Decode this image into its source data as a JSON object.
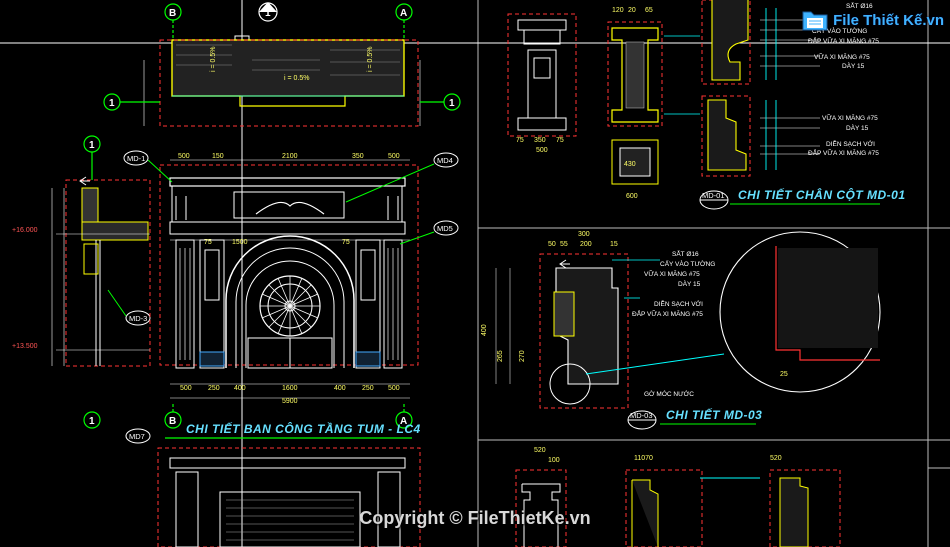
{
  "watermark": {
    "logo_text": "File Thiết Kế.vn",
    "copyright": "Copyright © FileThietKe.vn"
  },
  "titles": {
    "balcony": "CHI TIẾT BAN CÔNG TẦNG TUM - LC4",
    "column_base": "CHI TIẾT CHÂN CỘT MD-01",
    "md03": "CHI TIẾT MD-03"
  },
  "tags": {
    "md1": "MD-1",
    "md3_left": "MD-3",
    "md4": "MD4",
    "md5": "MD5",
    "md7": "MD7",
    "md01": "MD-01",
    "md03": "MD-03"
  },
  "grid_labels": {
    "b_top": "B",
    "a_top": "A",
    "one_top": "1",
    "one_left": "1",
    "one_right": "1",
    "one_mid": "1",
    "b_bot": "B",
    "a_bot": "A",
    "one_bot": "1"
  },
  "levels": {
    "upper": "+16.000",
    "lower": "+13.500"
  },
  "slopes": {
    "s1": "i = 0.5%",
    "s2": "i = 0.5%",
    "s3": "i = 0.5%"
  },
  "notes": {
    "n1": "SẮT Ø16",
    "n2": "CẤY VÀO TƯỜNG",
    "n3": "ĐẮP VỮA XI MĂNG #75",
    "n4": "VỮA XI MĂNG #75",
    "n5": "DÀY 15",
    "n6": "VỮA XI MĂNG #75",
    "n7": "DÀY 15",
    "n8": "DIỄN SẠCH VỚI",
    "n9": "ĐẮP VỮA XI MĂNG #75",
    "m1": "SẮT Ø16",
    "m2": "CẤY VÀO TƯỜNG",
    "m3": "VỮA XI MĂNG #75",
    "m4": "DÀY 15",
    "m5": "DIỄN SẠCH VỚI",
    "m6": "ĐẮP VỮA XI MĂNG #75",
    "m7": "GỜ MÓC NƯỚC"
  },
  "dims": {
    "d_500": "500",
    "d_150": "150",
    "d_2100": "2100",
    "d_350": "350",
    "d_500b": "500",
    "d_75a": "75",
    "d_1500": "1500",
    "d_75b": "75",
    "d_500c": "500",
    "d_250": "250",
    "d_400": "400",
    "d_1600": "1600",
    "d_400b": "400",
    "d_250b": "250",
    "d_500d": "500",
    "d_5900": "5900",
    "d_300": "300",
    "d_50": "50",
    "d_55": "55",
    "d_200": "200",
    "d_15": "15",
    "d_400v": "400",
    "d_265": "265",
    "d_270": "270",
    "d_100": "100",
    "d_520": "520",
    "d_75c": "75",
    "d_350b": "350",
    "d_75d": "75",
    "d_500e": "500",
    "d_120": "120",
    "d_20": "20",
    "d_65": "65",
    "d_600": "600",
    "d_430": "430",
    "d_25": "25",
    "d_11070": "11070",
    "d_520b": "520"
  }
}
